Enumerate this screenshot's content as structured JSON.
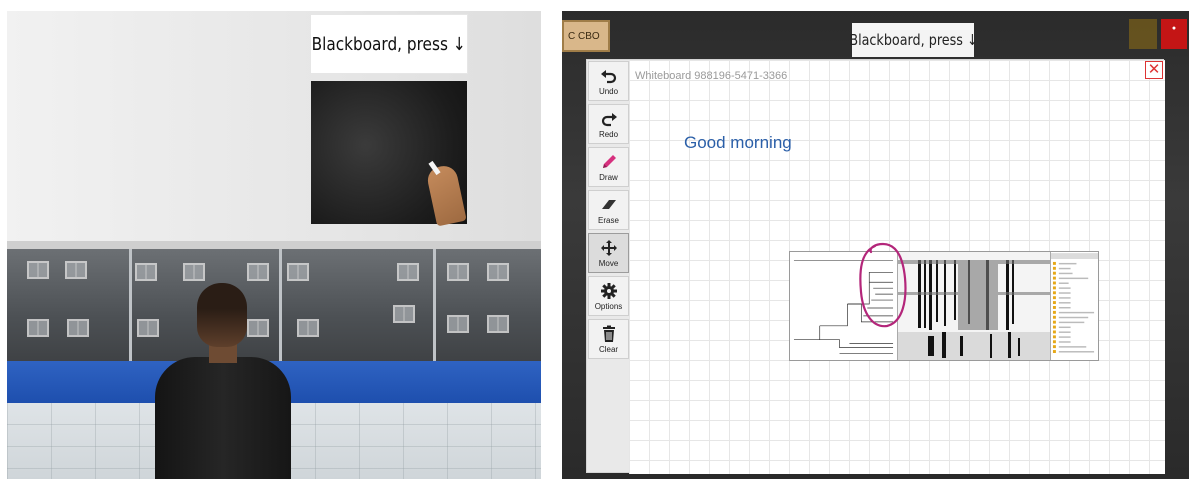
{
  "scene": {
    "sign_text": "Blackboard, press ↓"
  },
  "app": {
    "background": {
      "tag_text": "C CBO",
      "title": "Blackboard, press ↓"
    },
    "whiteboard": {
      "title": "Whiteboard 988196-5471-3366",
      "close_symbol": "✕",
      "greeting": "Good morning"
    },
    "toolbar": {
      "items": [
        {
          "label": "Undo",
          "icon": "undo-icon"
        },
        {
          "label": "Redo",
          "icon": "redo-icon"
        },
        {
          "label": "Draw",
          "icon": "pencil-icon"
        },
        {
          "label": "Erase",
          "icon": "eraser-icon"
        },
        {
          "label": "Move",
          "icon": "move-icon"
        },
        {
          "label": "Options",
          "icon": "gear-icon"
        },
        {
          "label": "Clear",
          "icon": "trash-icon"
        }
      ],
      "active": "Move"
    },
    "colors": {
      "annotation": "#b3267a",
      "greeting": "#2b5fa8",
      "draw_icon": "#d6307e"
    }
  }
}
